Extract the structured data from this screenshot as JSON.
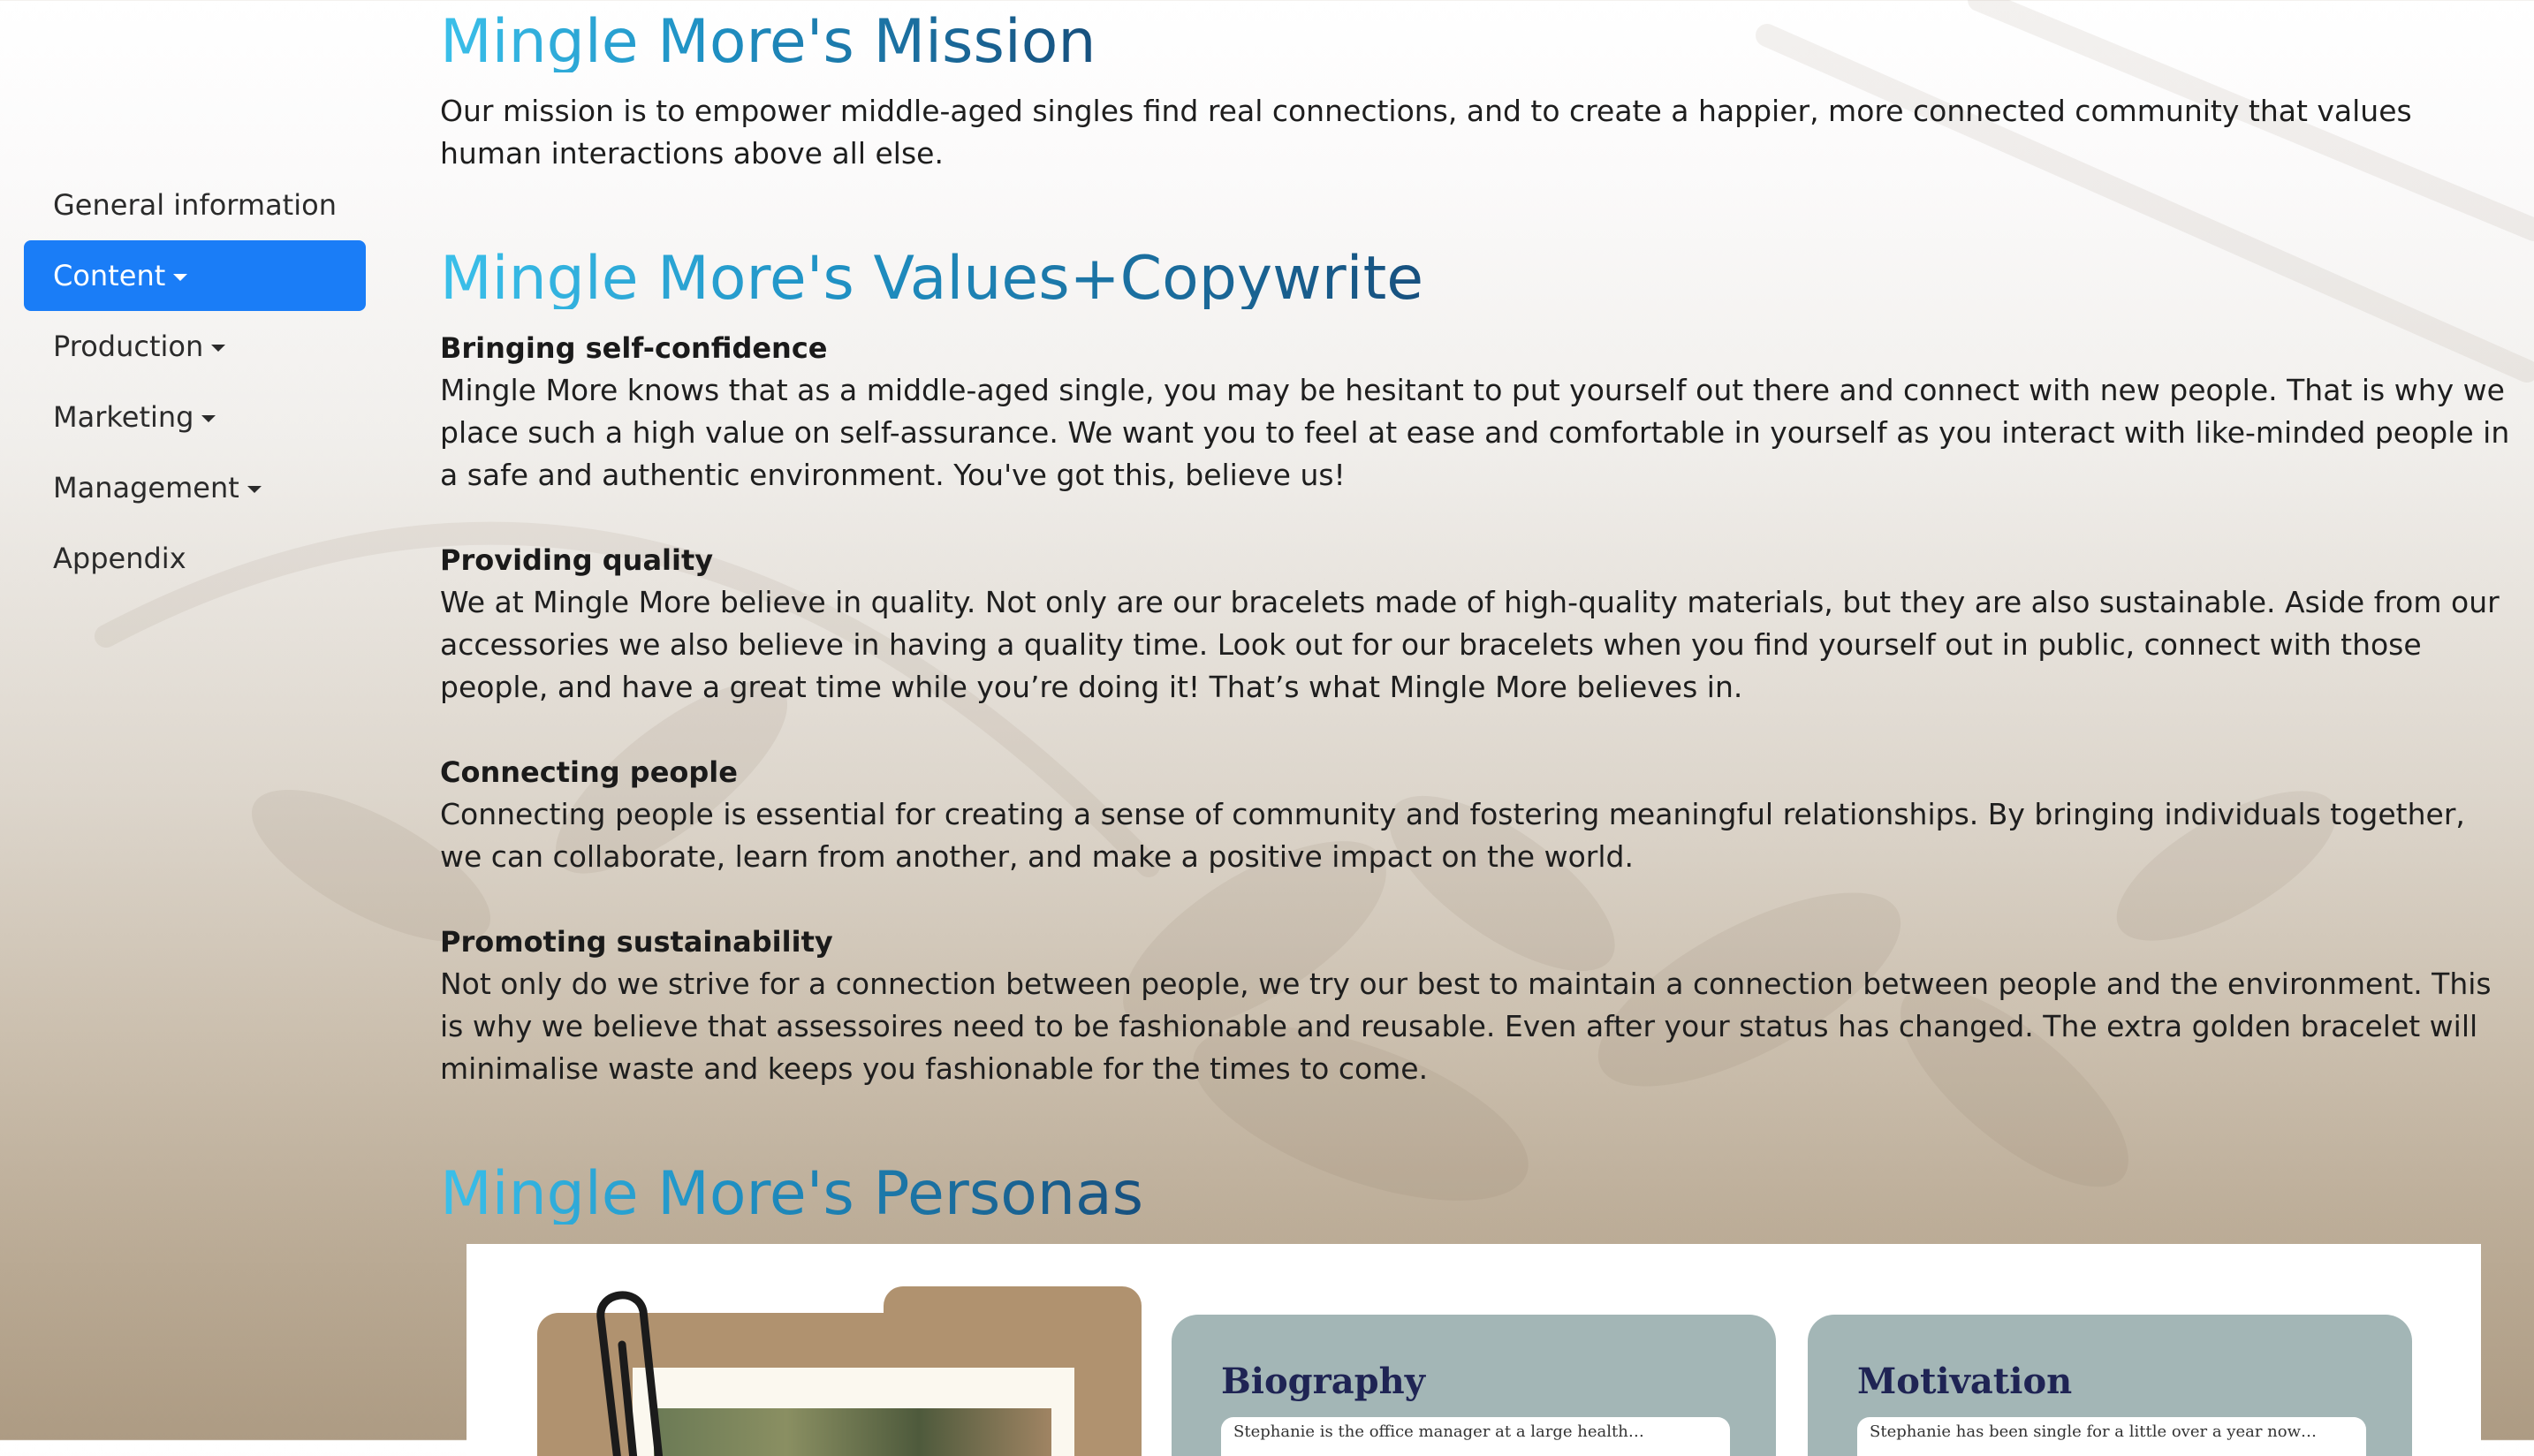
{
  "sidebar": {
    "items": [
      {
        "label": "General information",
        "has_dropdown": false,
        "active": false
      },
      {
        "label": "Content",
        "has_dropdown": true,
        "active": true
      },
      {
        "label": "Production",
        "has_dropdown": true,
        "active": false
      },
      {
        "label": "Marketing",
        "has_dropdown": true,
        "active": false
      },
      {
        "label": "Management",
        "has_dropdown": true,
        "active": false
      },
      {
        "label": "Appendix",
        "has_dropdown": false,
        "active": false
      }
    ]
  },
  "mission": {
    "title": "Mingle More's Mission",
    "text": "Our mission is to empower middle-aged singles find real connections, and to create a happier, more connected community that values human interactions above all else."
  },
  "values": {
    "title": "Mingle More's Values+Copywrite",
    "items": [
      {
        "heading": "Bringing self-confidence",
        "text": "Mingle More knows that as a middle-aged single, you may be hesitant to put yourself out there and connect with new people. That is why we place such a high value on self-assurance. We want you to feel at ease and comfortable in yourself as you interact with like-minded people in a safe and authentic environment. You've got this, believe us!"
      },
      {
        "heading": "Providing quality",
        "text": "We at Mingle More believe in quality. Not only are our bracelets made of high-quality materials, but they are also sustainable. Aside from our accessories we also believe in having a quality time. Look out for our bracelets when you find yourself out in public, connect with those people, and have a great time while you’re doing it! That’s what Mingle More believes in."
      },
      {
        "heading": "Connecting people",
        "text": "Connecting people is essential for creating a sense of community and fostering meaningful relationships. By bringing individuals together, we can collaborate, learn from another, and make a positive impact on the world."
      },
      {
        "heading": "Promoting sustainability",
        "text": "Not only do we strive for a connection between people, we try our best to maintain a connection between people and the environment. This is why we believe that assessoires need to be fashionable and reusable. Even after your status has changed. The extra golden bracelet will minimalise waste and keeps you fashionable for the times to come."
      }
    ]
  },
  "personas": {
    "title": "Mingle More's Personas",
    "cards": [
      {
        "title": "Biography",
        "snippet": "Stephanie is the office manager at a large health…"
      },
      {
        "title": "Motivation",
        "snippet": "Stephanie has been single for a little over a year now…"
      }
    ]
  },
  "colors": {
    "nav_active": "#1a7df7",
    "title_gradient": [
      "#3bc0ea",
      "#1f91c4",
      "#17507e"
    ],
    "card_bg": "#a3b6b6",
    "card_title": "#1f2454",
    "folder": "#b0926f"
  }
}
